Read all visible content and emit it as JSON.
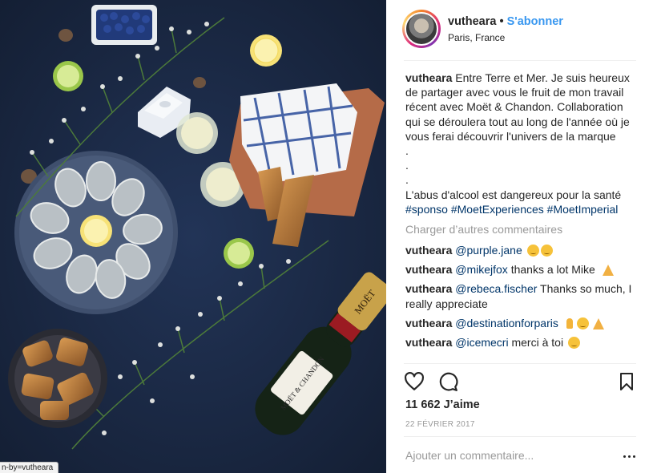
{
  "status_url": "n-by=vutheara",
  "post": {
    "username": "vutheara",
    "separator": "•",
    "follow_label": "S'abonner",
    "location": "Paris, France"
  },
  "caption": {
    "username": "vutheara",
    "text_lines": [
      "Entre Terre et Mer. Je suis heureux de partager avec vous le fruit de mon travail récent avec Moët & Chandon. Collaboration qui se déroulera tout au long de l'année où je vous ferai découvrir l'univers de la marque",
      ".",
      ".",
      ".",
      "L'abus d'alcool est dangereux pour la santé"
    ],
    "hashtags": [
      "#sponso",
      "#MoetExperiences",
      "#MoetImperial"
    ]
  },
  "load_more_label": "Charger d’autres commentaires",
  "comments": [
    {
      "username": "vutheara",
      "mention": "@purple.jane",
      "text": "",
      "emojis": [
        "face",
        "face"
      ]
    },
    {
      "username": "vutheara",
      "mention": "@mikejfox",
      "text": "thanks a lot Mike",
      "emojis": [
        "pray"
      ]
    },
    {
      "username": "vutheara",
      "mention": "@rebeca.fischer",
      "text": "Thanks so much, I really appreciate",
      "emojis": []
    },
    {
      "username": "vutheara",
      "mention": "@destinationforparis",
      "text": "",
      "emojis": [
        "hand",
        "face",
        "pray"
      ]
    },
    {
      "username": "vutheara",
      "mention": "@icemecri",
      "text": "merci à toi",
      "emojis": [
        "face"
      ]
    }
  ],
  "likes_label": "11 662 J’aime",
  "date_label": "22 FÉVRIER 2017",
  "add_comment": {
    "placeholder": "Ajouter un commentaire..."
  },
  "icons": {
    "like": "heart-icon",
    "comment": "comment-icon",
    "save": "bookmark-icon",
    "options": "more-options-icon"
  },
  "photo": {
    "bottle_label": "MOËT",
    "bottle_label_sub": "MOËT & CHANDON"
  },
  "colors": {
    "link": "#3897f0",
    "hashtag": "#003569",
    "muted": "#999999",
    "photo_background": "#1c2a44"
  }
}
